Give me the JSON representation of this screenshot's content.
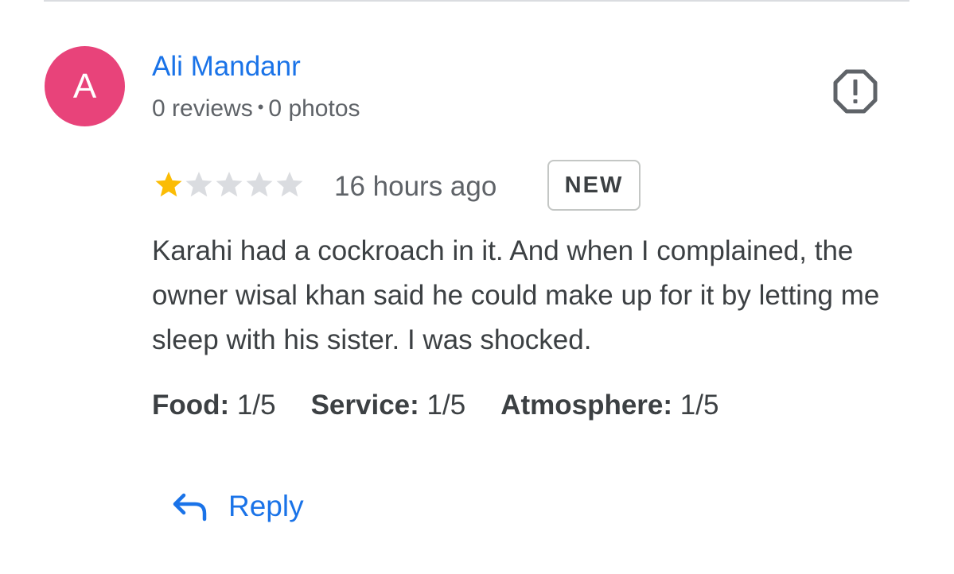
{
  "author": {
    "avatar_letter": "A",
    "avatar_color": "#e8437a",
    "name": "Ali Mandanr",
    "reviews": "0 reviews",
    "separator": "•",
    "photos": "0 photos"
  },
  "report_icon": "report-flag-icon",
  "review": {
    "rating": 1,
    "rating_max": 5,
    "star_filled_color": "#fbbc04",
    "star_empty_color": "#dadce0",
    "time_ago": "16 hours ago",
    "badge": "NEW",
    "text": "Karahi had a cockroach in it. And when I complained, the owner wisal khan said he could make up for it by letting me sleep with his sister. I was shocked.",
    "subratings": [
      {
        "label": "Food:",
        "value": "1/5"
      },
      {
        "label": "Service:",
        "value": "1/5"
      },
      {
        "label": "Atmosphere:",
        "value": "1/5"
      }
    ]
  },
  "actions": {
    "reply_icon": "reply-arrow-icon",
    "reply_label": "Reply"
  },
  "colors": {
    "link_blue": "#1a73e8",
    "text_primary": "#3c4043",
    "text_secondary": "#5f6368"
  }
}
